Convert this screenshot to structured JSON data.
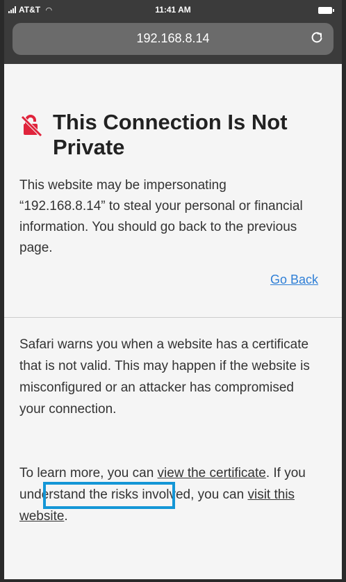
{
  "status_bar": {
    "carrier": "AT&T",
    "time": "11:41 AM"
  },
  "address_bar": {
    "url": "192.168.8.14"
  },
  "warning": {
    "title": "This Connection Is Not Private",
    "body": "This website may be impersonating “192.168.8.14” to steal your personal or financial information. You should go back to the previous page.",
    "go_back_label": "Go Back"
  },
  "info": {
    "paragraph": "Safari warns you when a website has a certificate that is not valid. This may happen if the website is misconfigured or an attacker has compromised your connection.",
    "learn_prefix": "To learn more, you can ",
    "view_certificate_label": "view the certificate",
    "learn_middle": ". If you understand the risks involved, you can ",
    "visit_website_label": "visit this website",
    "learn_suffix": "."
  },
  "colors": {
    "chrome": "#3b3b3b",
    "link_blue": "#2f7fd6",
    "highlight_blue": "#1496d6",
    "lock_red": "#e0243c"
  },
  "icons": {
    "status": [
      "signal-icon",
      "wifi-icon",
      "battery-icon"
    ],
    "address": "reload-icon",
    "heading": "broken-lock-icon"
  }
}
